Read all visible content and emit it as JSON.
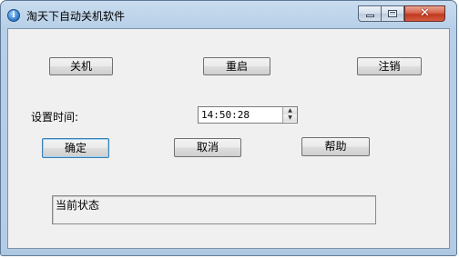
{
  "window": {
    "title": "淘天下自动关机软件",
    "icon": "info-icon",
    "controls": {
      "minimize": "minimize-icon",
      "maximize": "maximize-icon",
      "close": "close-icon",
      "close_glyph": "✕"
    }
  },
  "buttons": {
    "shutdown": "关机",
    "restart": "重启",
    "logoff": "注销",
    "confirm": "确定",
    "cancel": "取消",
    "help": "帮助"
  },
  "time": {
    "label": "设置时间:",
    "value": "14:50:28"
  },
  "status": {
    "text": "当前状态"
  },
  "colors": {
    "titlebar": "#b7cfe7",
    "client_bg": "#f0f0f0",
    "close_red": "#c0391f"
  }
}
